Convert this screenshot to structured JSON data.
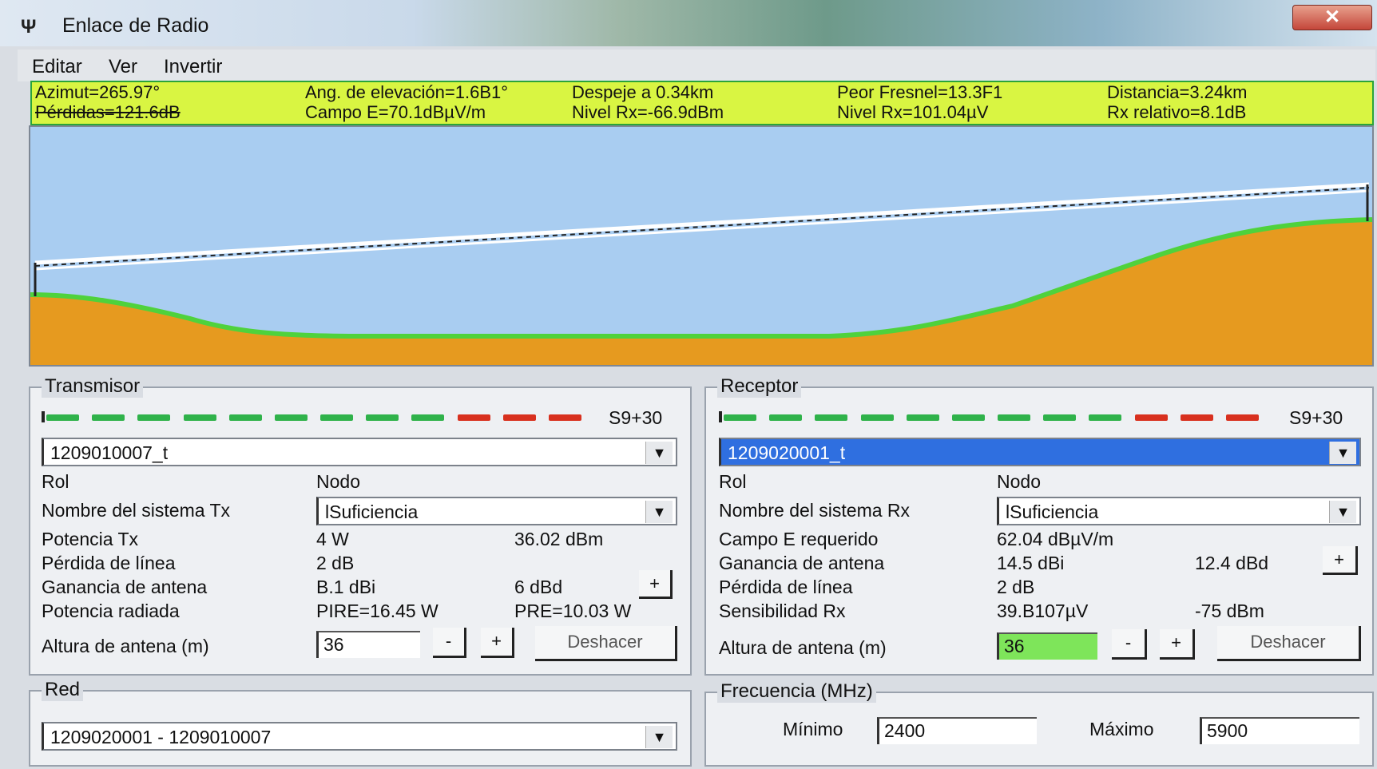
{
  "window": {
    "title": "Enlace de Radio",
    "close_label": "✕"
  },
  "menu": {
    "editar": "Editar",
    "ver": "Ver",
    "invertir": "Invertir"
  },
  "stats": {
    "azimut": "Azimut=265.97°",
    "perdidas": "Pérdidas=121.6dB",
    "ang_elevacion": "Ang. de elevación=1.6B1°",
    "campo_e": "Campo E=70.1dBµV/m",
    "despeje": "Despeje a 0.34km",
    "nivel_rx_dbm": "Nivel Rx=-66.9dBm",
    "peor_fresnel": "Peor Fresnel=13.3F1",
    "nivel_rx_uv": "Nivel Rx=101.04µV",
    "distancia": "Distancia=3.24km",
    "rx_relativo": "Rx relativo=8.1dB",
    "bar_color": "#d9f542",
    "border_color": "#2aa43a"
  },
  "profile": {
    "sky_color": "#a9cdf1",
    "terrain_color": "#e69a1f",
    "ground_line_color": "#4fd23c"
  },
  "transmisor": {
    "legend": "Transmisor",
    "level_label": "S9+30",
    "level_segments_green": 9,
    "level_segments_red": 3,
    "unit_select": "1209010007_t",
    "rol_label": "Rol",
    "rol_value": "Nodo",
    "sistema_label": "Nombre del sistema Tx",
    "sistema_value": "lSuficiencia",
    "potencia_label": "Potencia Tx",
    "potencia_w": "4 W",
    "potencia_dbm": "36.02 dBm",
    "perdida_label": "Pérdida de línea",
    "perdida_value": "2 dB",
    "ganancia_label": "Ganancia de antena",
    "ganancia_dbi": "B.1 dBi",
    "ganancia_dbd": "6 dBd",
    "plus_label": "+",
    "potencia_rad_label": "Potencia radiada",
    "pire": "PIRE=16.45 W",
    "pre": "PRE=10.03 W",
    "altura_label": "Altura de antena (m)",
    "altura_value": "36",
    "minus_btn": "-",
    "plus_btn": "+",
    "deshacer": "Deshacer"
  },
  "receptor": {
    "legend": "Receptor",
    "level_label": "S9+30",
    "level_segments_green": 9,
    "level_segments_red": 3,
    "unit_select": "1209020001_t",
    "rol_label": "Rol",
    "rol_value": "Nodo",
    "sistema_label": "Nombre del sistema Rx",
    "sistema_value": "lSuficiencia",
    "campo_label": "Campo E requerido",
    "campo_value": "62.04 dBµV/m",
    "ganancia_label": "Ganancia de antena",
    "ganancia_dbi": "14.5 dBi",
    "ganancia_dbd": "12.4 dBd",
    "plus_label": "+",
    "perdida_label": "Pérdida de línea",
    "perdida_value": "2 dB",
    "sensibilidad_label": "Sensibilidad Rx",
    "sensibilidad_uv": "39.B107µV",
    "sensibilidad_dbm": "-75 dBm",
    "altura_label": "Altura de antena (m)",
    "altura_value": "36",
    "minus_btn": "-",
    "plus_btn": "+",
    "deshacer": "Deshacer"
  },
  "red": {
    "legend": "Red",
    "select_value": "1209020001 - 1209010007"
  },
  "frecuencia": {
    "legend": "Frecuencia (MHz)",
    "minimo_label": "Mínimo",
    "minimo_value": "2400",
    "maximo_label": "Máximo",
    "maximo_value": "5900"
  }
}
